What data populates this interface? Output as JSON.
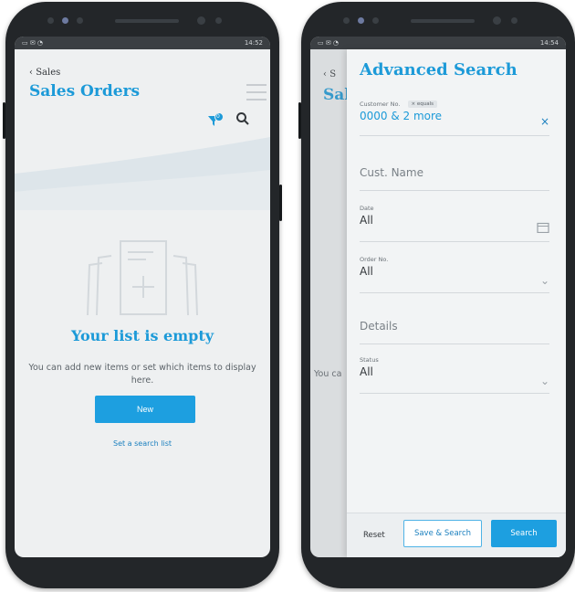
{
  "left_screen": {
    "status_left": "▭ ✉ ◔",
    "status_right": "14:52",
    "back_label": "Sales",
    "title": "Sales Orders",
    "empty_title": "Your list is empty",
    "empty_text": "You can add new items or set which items to display here.",
    "new_button": "New",
    "search_list_link": "Set a search list",
    "filter_badge": "0",
    "icons": [
      "chevron-left-icon",
      "hamburger-icon",
      "filter-icon",
      "search-icon",
      "empty-list-illustration"
    ]
  },
  "right_screen": {
    "status_left": "▭ ✉ ◔",
    "status_right": "14:54",
    "background": {
      "back_label": "S",
      "title": "Sal",
      "text": "You ca"
    },
    "panel": {
      "title": "Advanced Search",
      "fields": [
        {
          "label": "Customer No.",
          "chip": "equals",
          "value": "0000 & 2 more",
          "action": "×"
        },
        {
          "placeholder": "Cust. Name"
        },
        {
          "label": "Date",
          "value": "All"
        },
        {
          "label": "Order No.",
          "value": "All"
        },
        {
          "placeholder": "Details"
        },
        {
          "label": "Status",
          "value": "All"
        }
      ],
      "footer": {
        "reset": "Reset",
        "save_search": "Save & Search",
        "search": "Search"
      }
    }
  },
  "colors": {
    "accent": "#1d9fe0",
    "title_blue": "#1c9ad8",
    "phone_body": "#232629",
    "screen_bg": "#eef0f1"
  }
}
